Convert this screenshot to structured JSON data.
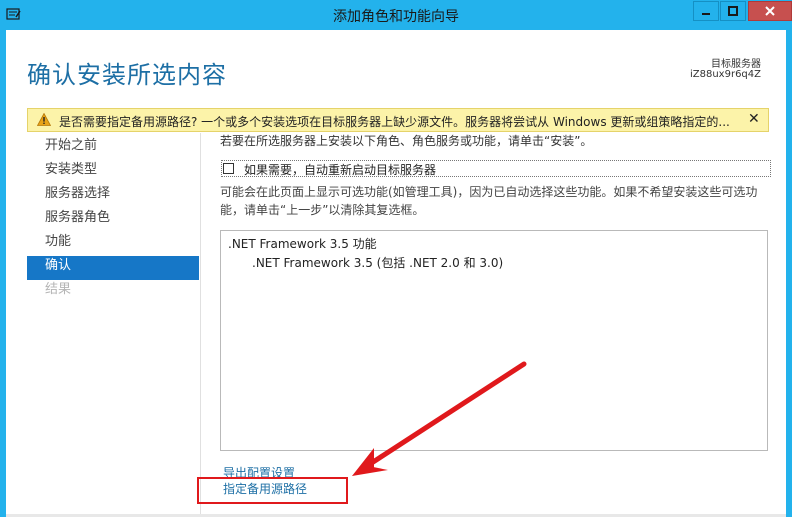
{
  "window": {
    "title": "添加角色和功能向导",
    "title_color": "#23b2ec"
  },
  "header": {
    "page_title": "确认安装所选内容",
    "destination_label": "目标服务器",
    "destination_value": "iZ88ux9r6q4Z"
  },
  "warning": {
    "text": "是否需要指定备用源路径? 一个或多个安装选项在目标服务器上缺少源文件。服务器将尝试从 Windows 更新或组策略指定的...",
    "close_glyph": "✕"
  },
  "nav": {
    "items": [
      {
        "label": "开始之前",
        "state": "normal"
      },
      {
        "label": "安装类型",
        "state": "normal"
      },
      {
        "label": "服务器选择",
        "state": "normal"
      },
      {
        "label": "服务器角色",
        "state": "normal"
      },
      {
        "label": "功能",
        "state": "normal"
      },
      {
        "label": "确认",
        "state": "active"
      },
      {
        "label": "结果",
        "state": "disabled"
      }
    ]
  },
  "content": {
    "intro": "若要在所选服务器上安装以下角色、角色服务或功能，请单击“安装”。",
    "restart_label": "如果需要，自动重新启动目标服务器",
    "restart_checked": false,
    "info": "可能会在此页面上显示可选功能(如管理工具)，因为已自动选择这些功能。如果不希望安装这些可选功能，请单击“上一步”以清除其复选框。",
    "features": {
      "parent": ".NET Framework 3.5 功能",
      "child": ".NET Framework 3.5 (包括 .NET 2.0 和 3.0)"
    },
    "links": {
      "export": "导出配置设置",
      "alt_source": "指定备用源路径"
    }
  },
  "colors": {
    "accent": "#1677c7",
    "annotation": "#e0191c",
    "warning_bg": "#fcf3a9"
  }
}
